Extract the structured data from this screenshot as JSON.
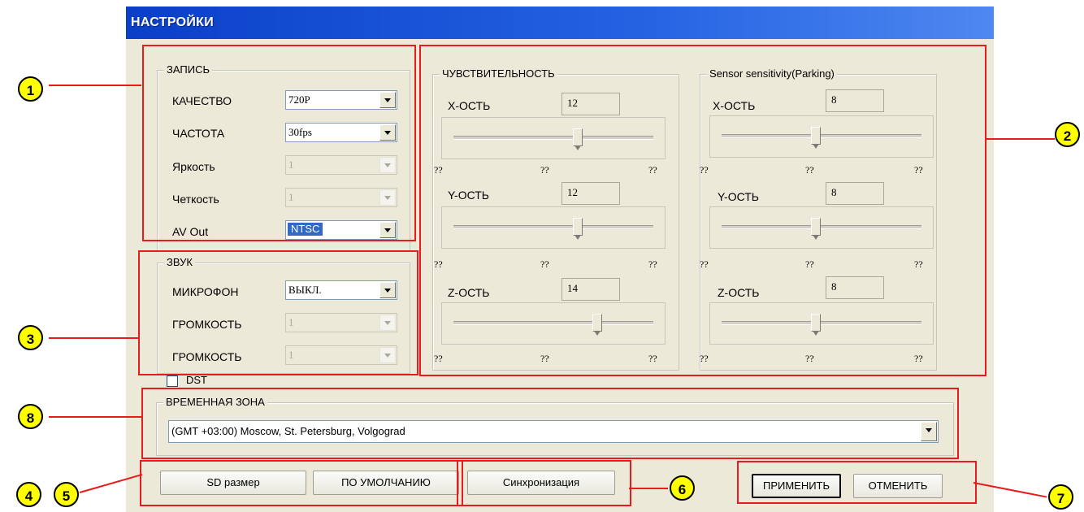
{
  "window": {
    "title": "НАСТРОЙКИ"
  },
  "record": {
    "legend": "ЗАПИСЬ",
    "rows": [
      {
        "label": "КАЧЕСТВО",
        "value": "720P"
      },
      {
        "label": "ЧАСТОТА",
        "value": "30fps"
      },
      {
        "label": "Яркость",
        "value": "1"
      },
      {
        "label": "Четкость",
        "value": "1"
      },
      {
        "label": "AV Out",
        "value": "NTSC"
      }
    ]
  },
  "sound": {
    "legend": "ЗВУК",
    "rows": [
      {
        "label": "МИКРОФОН",
        "value": "ВЫКЛ."
      },
      {
        "label": "ГРОМКОСТЬ",
        "value": "1"
      },
      {
        "label": "ГРОМКОСТЬ",
        "value": "1"
      }
    ]
  },
  "sensitivity": {
    "legend": "ЧУВСТВИТЕЛЬНОСТЬ",
    "axes": [
      {
        "label": "X-ОСТЬ",
        "value": "12",
        "level": 0.62
      },
      {
        "label": "Y-ОСТЬ",
        "value": "12",
        "level": 0.62
      },
      {
        "label": "Z-ОСТЬ",
        "value": "14",
        "level": 0.72
      }
    ],
    "tick_label": "??"
  },
  "parking": {
    "legend": "Sensor sensitivity(Parking)",
    "axes": [
      {
        "label": "X-ОСТЬ",
        "value": "8",
        "level": 0.47
      },
      {
        "label": "Y-ОСТЬ",
        "value": "8",
        "level": 0.47
      },
      {
        "label": "Z-ОСТЬ",
        "value": "8",
        "level": 0.47
      }
    ],
    "tick_label": "??"
  },
  "dst": {
    "label": "DST",
    "checked": false
  },
  "timezone": {
    "legend": "ВРЕМЕННАЯ ЗОНА",
    "value": "(GMT +03:00) Moscow, St. Petersburg, Volgograd"
  },
  "buttons": {
    "sd_size": "SD размер",
    "defaults": "ПО УМОЛЧАНИЮ",
    "sync": "Синхронизация",
    "apply": "ПРИМЕНИТЬ",
    "cancel": "ОТМЕНИТЬ"
  },
  "markers": [
    "1",
    "2",
    "3",
    "4",
    "5",
    "6",
    "7",
    "8"
  ],
  "colors": {
    "annotation": "#e81c1c",
    "marker_fill": "#ffff00",
    "title_bar": "#0a3fc8"
  }
}
